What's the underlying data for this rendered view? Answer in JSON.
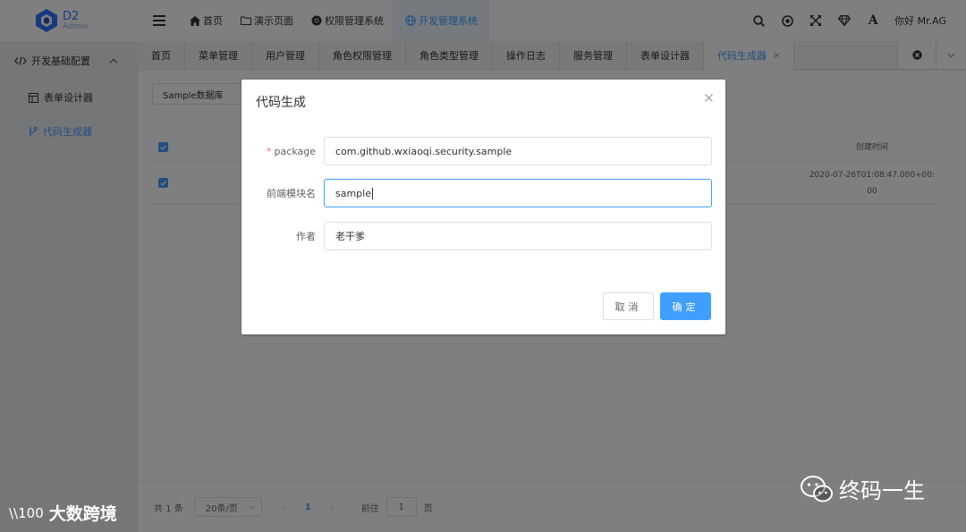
{
  "app": {
    "logo_name": "D2",
    "logo_sub": "Admin"
  },
  "header": {
    "nav": [
      {
        "label": "首页",
        "icon": "home-icon"
      },
      {
        "label": "演示页面",
        "icon": "folder-icon"
      },
      {
        "label": "权限管理系统",
        "icon": "chrome-icon"
      },
      {
        "label": "开发管理系统",
        "icon": "globe-icon"
      }
    ],
    "active_nav": "开发管理系统",
    "icons": [
      "search-icon",
      "target-icon",
      "fullscreen-icon",
      "diamond-icon",
      "font-size-icon"
    ],
    "font_icon_text": "A",
    "greeting": "你好 Mr.AG"
  },
  "sidebar": {
    "group_label": "开发基础配置",
    "items": [
      {
        "label": "表单设计器",
        "icon": "form-icon"
      },
      {
        "label": "代码生成器",
        "icon": "branch-icon"
      }
    ]
  },
  "tabs": {
    "items": [
      "首页",
      "菜单管理",
      "用户管理",
      "角色权限管理",
      "角色类型管理",
      "操作日志",
      "服务管理",
      "表单设计器",
      "代码生成器"
    ],
    "active": "代码生成器",
    "close_glyph": "×"
  },
  "main": {
    "db_select_value": "Sample数据库",
    "table": {
      "header_time": "创建时间",
      "rows": [
        {
          "time_line1": "2020-07-26T01:08:47.000+00:",
          "time_line2": "00"
        }
      ]
    },
    "pager": {
      "total": "共 1 条",
      "page_size": "20条/页",
      "prev": "‹",
      "current": "1",
      "next": "›",
      "goto_label": "前往",
      "goto_value": "1",
      "page_suffix": "页"
    }
  },
  "dialog": {
    "title": "代码生成",
    "fields": [
      {
        "label": "package",
        "required": true,
        "value": "com.github.wxiaoqi.security.sample"
      },
      {
        "label": "前端模块名",
        "required": false,
        "value": "sample"
      },
      {
        "label": "作者",
        "required": false,
        "value": "老干爹"
      }
    ],
    "required_mark": "*",
    "cancel_label": "取消",
    "ok_label": "确定"
  },
  "watermarks": {
    "left_badge": "\\\\100",
    "left_text": "大数跨境",
    "right_text": "终码一生"
  },
  "colors": {
    "primary": "#409eff",
    "danger": "#f56c6c",
    "text": "#303133"
  }
}
